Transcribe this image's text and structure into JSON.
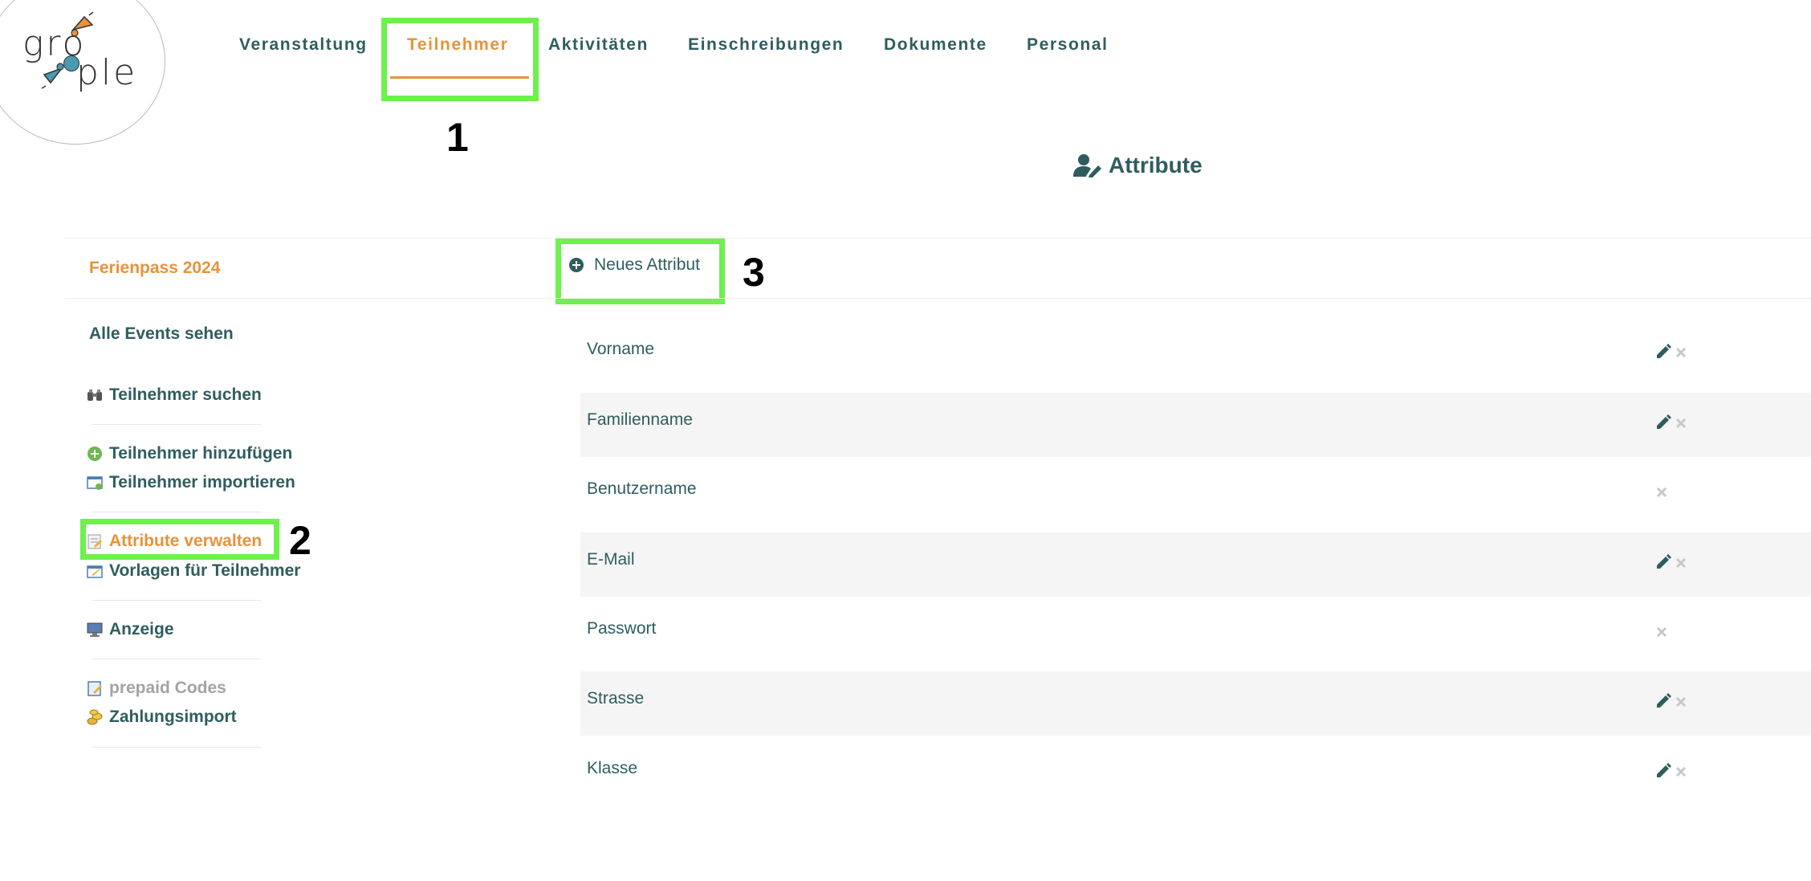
{
  "logo": {
    "text_top": "gro",
    "text_bottom": "ple",
    "colors": {
      "orange": "#e8923a",
      "teal": "#4a9ab0"
    }
  },
  "topnav": {
    "items": [
      {
        "label": "Veranstaltung"
      },
      {
        "label": "Teilnehmer",
        "active": true
      },
      {
        "label": "Aktivitäten"
      },
      {
        "label": "Einschreibungen"
      },
      {
        "label": "Dokumente"
      },
      {
        "label": "Personal"
      }
    ]
  },
  "annotations": {
    "n1": "1",
    "n2": "2",
    "n3": "3",
    "highlight_color": "#6ef04d"
  },
  "page": {
    "title": "Attribute",
    "title_icon": "user-edit-icon"
  },
  "sidebar": {
    "event": "Ferienpass 2024",
    "all_events": "Alle Events sehen",
    "items": [
      {
        "label": "Teilnehmer suchen",
        "icon": "binoculars-icon"
      },
      {
        "label": "Teilnehmer hinzufügen",
        "icon": "plus-circle-icon"
      },
      {
        "label": "Teilnehmer importieren",
        "icon": "import-icon"
      },
      {
        "label": "Attribute verwalten",
        "icon": "edit-form-icon",
        "active": true
      },
      {
        "label": "Vorlagen für Teilnehmer",
        "icon": "template-icon"
      },
      {
        "label": "Anzeige",
        "icon": "monitor-icon"
      },
      {
        "label": "prepaid Codes",
        "icon": "notepad-icon",
        "disabled": true
      },
      {
        "label": "Zahlungsimport",
        "icon": "coins-icon"
      }
    ]
  },
  "main": {
    "new_button": "Neues Attribut",
    "attributes": [
      {
        "label": "Vorname",
        "editable": true
      },
      {
        "label": "Familienname",
        "editable": true
      },
      {
        "label": "Benutzername",
        "editable": false
      },
      {
        "label": "E-Mail",
        "editable": true
      },
      {
        "label": "Passwort",
        "editable": false
      },
      {
        "label": "Strasse",
        "editable": true
      },
      {
        "label": "Klasse",
        "editable": true
      }
    ]
  },
  "colors": {
    "accent": "#e8923a",
    "text": "#2f5d5f",
    "row_alt": "#f5f5f5"
  }
}
